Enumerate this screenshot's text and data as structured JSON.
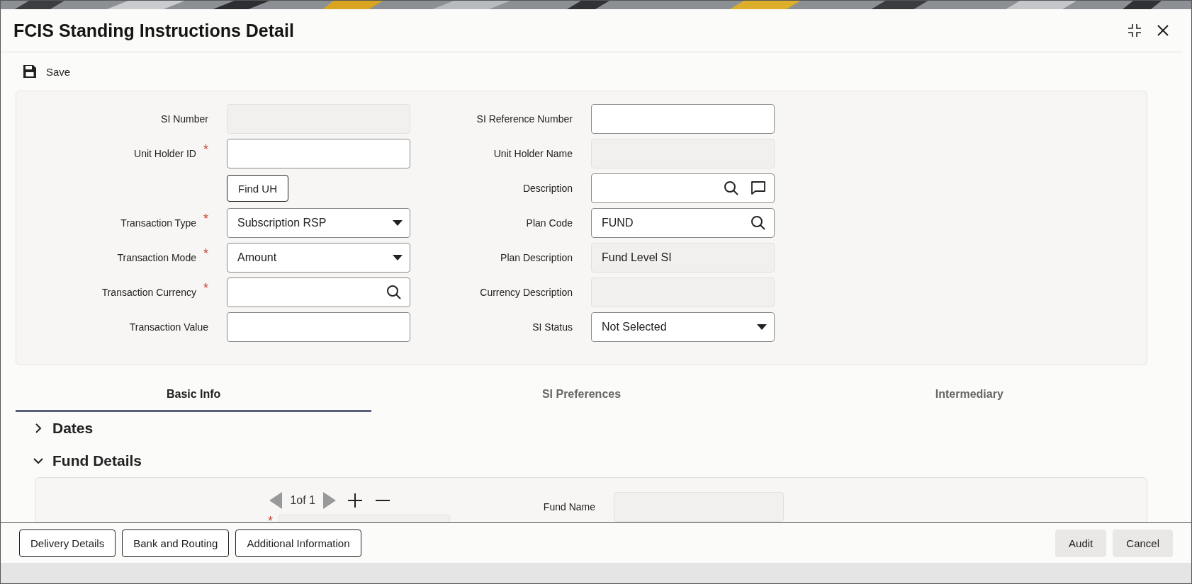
{
  "window": {
    "title": "FCIS Standing Instructions Detail"
  },
  "toolbar": [
    {
      "label": "Save",
      "kind": "save"
    }
  ],
  "form": {
    "left": [
      {
        "label": "SI Number",
        "kind": "readonly"
      },
      {
        "label": "Unit Holder ID",
        "kind": "text",
        "required_mark": "*"
      },
      {
        "label": "Find UH",
        "kind": "button"
      },
      {
        "label": "Transaction Type",
        "kind": "select",
        "value": "Subscription RSP",
        "required_mark": "*"
      },
      {
        "label": "Transaction Mode",
        "kind": "select",
        "value": "Amount",
        "required_mark": "*"
      },
      {
        "label": "Transaction Currency",
        "kind": "lookup",
        "required_mark": "*"
      },
      {
        "label": "Transaction Value",
        "kind": "text"
      }
    ],
    "right": [
      {
        "label": "SI Reference Number",
        "kind": "text"
      },
      {
        "label": "Unit Holder Name",
        "kind": "readonly"
      },
      {
        "label": "Description",
        "kind": "lookup-comment"
      },
      {
        "label": "Plan Code",
        "kind": "lookup",
        "value": "FUND"
      },
      {
        "label": "Plan Description",
        "kind": "readonly",
        "value": "Fund Level SI"
      },
      {
        "label": "Currency Description",
        "kind": "readonly"
      },
      {
        "label": "SI Status",
        "kind": "select",
        "value": "Not Selected"
      }
    ]
  },
  "tabs": [
    {
      "label": "Basic Info",
      "selected": true
    },
    {
      "label": "SI Preferences",
      "selected": false
    },
    {
      "label": "Intermediary",
      "selected": false
    }
  ],
  "sections": [
    {
      "title": "Dates",
      "expanded": false
    },
    {
      "title": "Fund Details",
      "expanded": true
    }
  ],
  "fund_details": {
    "pager": "1of 1",
    "fund_name_label": "Fund Name",
    "hidden_row_required_mark": "*"
  },
  "footer": {
    "left_buttons": [
      "Delivery Details",
      "Bank and Routing",
      "Additional Information"
    ],
    "right_buttons": [
      "Audit",
      "Cancel"
    ]
  }
}
